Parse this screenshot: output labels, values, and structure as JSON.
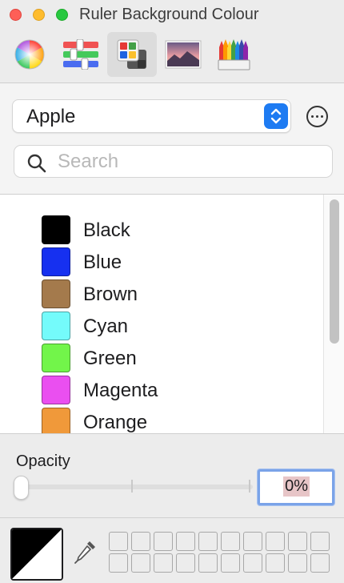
{
  "window": {
    "title": "Ruler Background Colour"
  },
  "toolbar": {
    "modes": [
      {
        "name": "colour-wheel",
        "icon": "colour-wheel-icon"
      },
      {
        "name": "colour-sliders",
        "icon": "sliders-icon"
      },
      {
        "name": "colour-palettes",
        "icon": "palettes-icon",
        "selected": true
      },
      {
        "name": "image-palettes",
        "icon": "image-icon"
      },
      {
        "name": "pencils",
        "icon": "pencils-icon"
      }
    ]
  },
  "palette": {
    "selected_list": "Apple"
  },
  "search": {
    "placeholder": "Search",
    "value": ""
  },
  "colors": [
    {
      "name": "Black",
      "hex": "#000000"
    },
    {
      "name": "Blue",
      "hex": "#1630f0"
    },
    {
      "name": "Brown",
      "hex": "#a47a4c"
    },
    {
      "name": "Cyan",
      "hex": "#74fbfb"
    },
    {
      "name": "Green",
      "hex": "#72f54a"
    },
    {
      "name": "Magenta",
      "hex": "#ea4ff0"
    },
    {
      "name": "Orange",
      "hex": "#f0993a"
    }
  ],
  "opacity": {
    "label": "Opacity",
    "value": 0,
    "display": "0%"
  },
  "accent": "#1e7bf2"
}
